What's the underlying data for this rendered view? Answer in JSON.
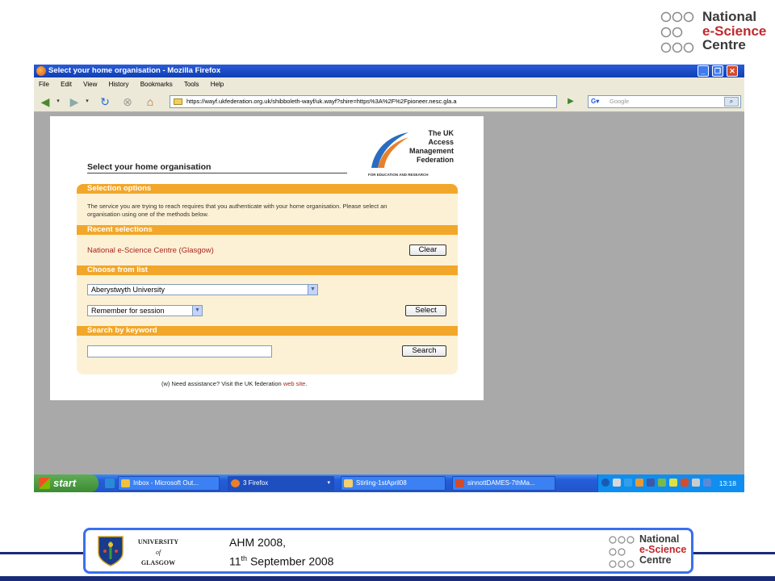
{
  "header_logo": {
    "line1": "National",
    "line2": "e-Science",
    "line3": "Centre"
  },
  "browser": {
    "window_title": "Select your home organisation - Mozilla Firefox",
    "menu": [
      "File",
      "Edit",
      "View",
      "History",
      "Bookmarks",
      "Tools",
      "Help"
    ],
    "url": "https://wayf.ukfederation.org.uk/shibboleth-wayf/uk.wayf?shire=https%3A%2F%2Fpioneer.nesc.gla.a",
    "search_placeholder": "Google"
  },
  "page": {
    "heading": "Select your home organisation",
    "federation_logo": {
      "line1": "The UK",
      "line2": "Access",
      "line3": "Management",
      "line4": "Federation",
      "subtitle": "FOR EDUCATION AND RESEARCH"
    },
    "sections": {
      "selection_options": "Selection options",
      "recent_selections": "Recent selections",
      "choose_from_list": "Choose from list",
      "search_by_keyword": "Search by keyword"
    },
    "intro_text": "The service you are trying to reach requires that you authenticate with your home organisation. Please select an organisation using one of the methods below.",
    "recent_org": "National e-Science Centre (Glasgow)",
    "clear_label": "Clear",
    "org_select_value": "Aberystwyth University",
    "remember_select_value": "Remember for session",
    "select_label": "Select",
    "keyword_value": "",
    "search_label": "Search",
    "assist_prefix": "(w)",
    "assist_text": "Need assistance? Visit the UK federation",
    "assist_link": "web site",
    "assist_end": "."
  },
  "taskbar": {
    "start_label": "start",
    "tasks": [
      "Inbox - Microsoft Out...",
      "3 Firefox",
      "Stirling-1stApril08",
      "sinnottDAMES-7thMa..."
    ],
    "clock": "13:18"
  },
  "footer": {
    "uni_line1": "UNIVERSITY",
    "uni_line2": "of",
    "uni_line3": "GLASGOW",
    "event": "AHM 2008,",
    "date_day": "11",
    "date_suffix": "th",
    "date_rest": " September 2008",
    "nesc_line1": "National",
    "nesc_line2": "e-Science",
    "nesc_line3": "Centre"
  },
  "colors": {
    "section_bar": "#f2a72a",
    "panel_bg": "#fdf1d5",
    "link_red": "#a8251f",
    "xp_blue": "#245edb",
    "footer_border": "#3a6ff0"
  }
}
